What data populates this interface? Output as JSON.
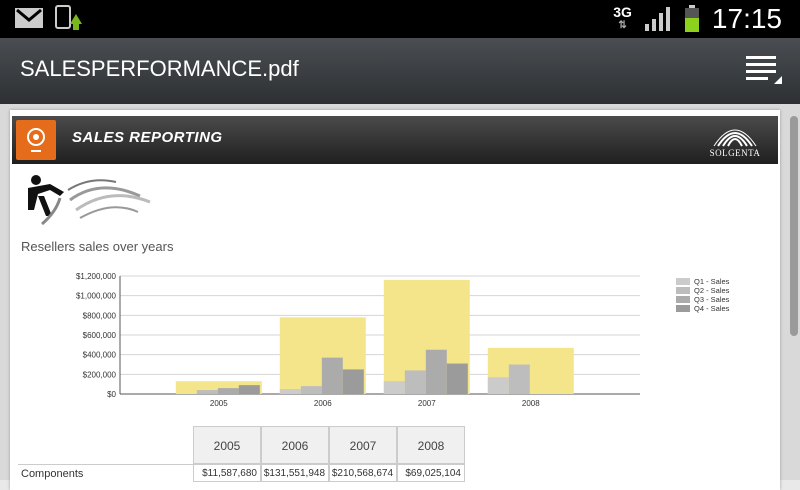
{
  "status_bar": {
    "network_type": "3G",
    "clock": "17:15",
    "icons": [
      "gmail-icon",
      "download-icon",
      "signal-icon",
      "battery-icon"
    ]
  },
  "action_bar": {
    "title": "SALESPERFORMANCE.pdf",
    "menu_icon": "overflow-menu-icon"
  },
  "document": {
    "banner_title": "SALES REPORTING",
    "brand": "SOLGENTA",
    "subtitle": "Resellers sales over years",
    "table": {
      "headers": [
        "2005",
        "2006",
        "2007",
        "2008"
      ],
      "rows": [
        {
          "label": "Components",
          "values": [
            "$11,587,680",
            "$131,551,948",
            "$210,568,674",
            "$69,025,104"
          ]
        }
      ]
    }
  },
  "chart_data": {
    "type": "bar",
    "categories": [
      "2005",
      "2006",
      "2007",
      "2008"
    ],
    "ylim": [
      0,
      1200000
    ],
    "yticks": [
      "$0",
      "$200,000",
      "$400,000",
      "$600,000",
      "$800,000",
      "$1,000,000",
      "$1,200,000"
    ],
    "background_series": {
      "name": "",
      "values": [
        130000,
        780000,
        1160000,
        470000
      ],
      "color": "#f5e58a"
    },
    "series": [
      {
        "name": "Q1 - Sales",
        "values": [
          0,
          50000,
          130000,
          170000
        ],
        "color": "#cbcbcb"
      },
      {
        "name": "Q2 - Sales",
        "values": [
          40000,
          80000,
          240000,
          300000
        ],
        "color": "#bdbdbd"
      },
      {
        "name": "Q3 - Sales",
        "values": [
          60000,
          370000,
          450000,
          0
        ],
        "color": "#ababab"
      },
      {
        "name": "Q4 - Sales",
        "values": [
          90000,
          250000,
          310000,
          0
        ],
        "color": "#9b9b9b"
      }
    ],
    "grid": true,
    "legend": "right"
  }
}
